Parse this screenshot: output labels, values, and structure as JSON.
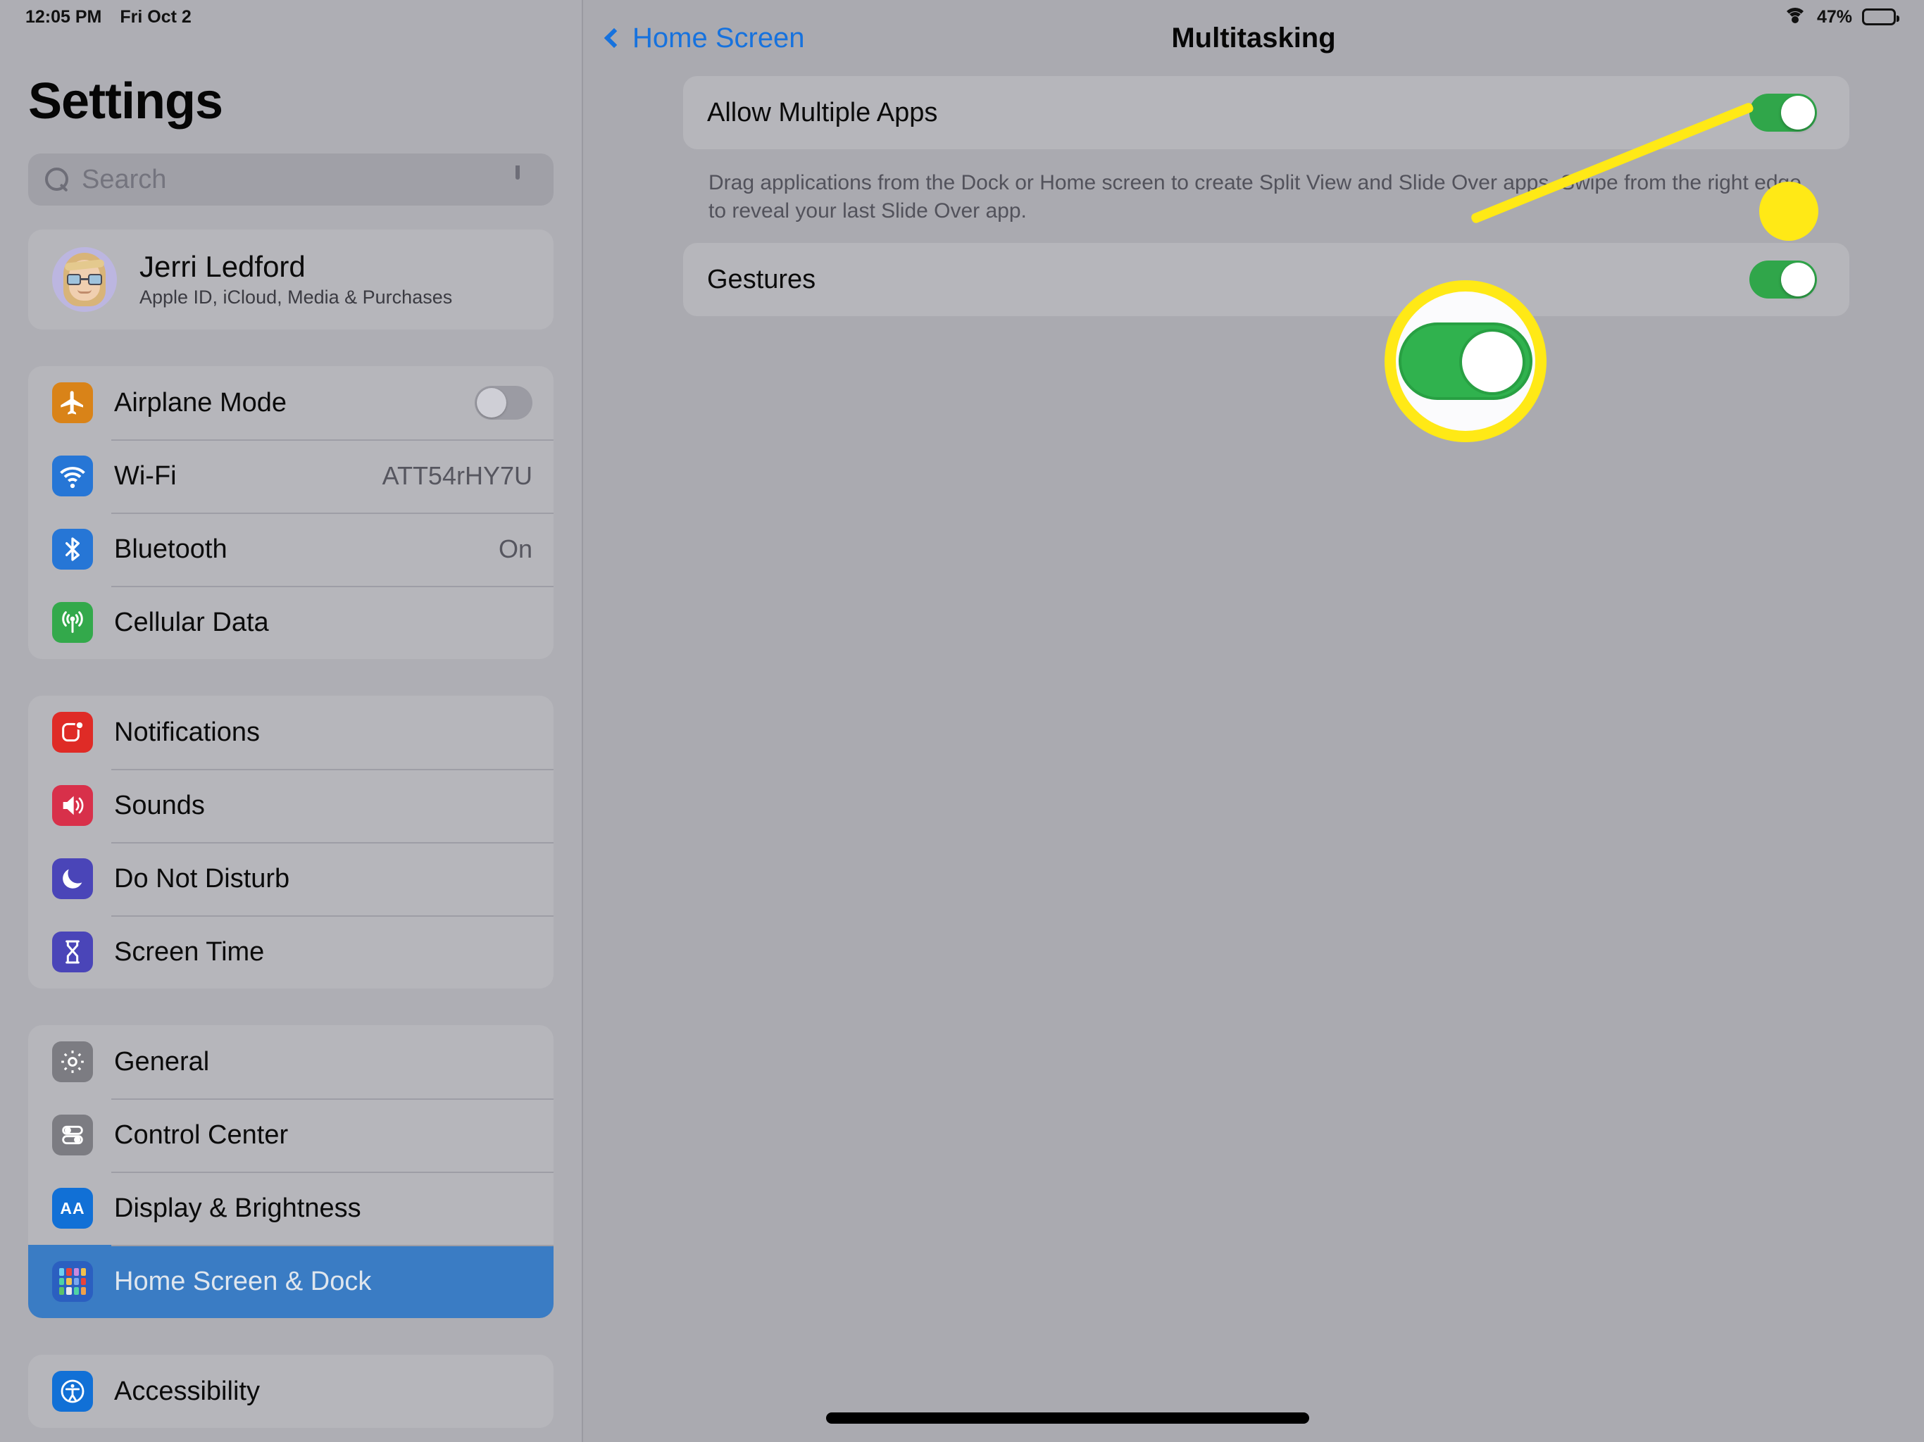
{
  "status_bar": {
    "time": "12:05 PM",
    "date": "Fri Oct 2",
    "wifi_icon": "wifi-icon",
    "battery_percent": "47%",
    "battery_level": 47
  },
  "sidebar": {
    "title": "Settings",
    "search": {
      "placeholder": "Search",
      "search_icon": "search-icon",
      "mic_icon": "microphone-icon"
    },
    "profile": {
      "name": "Jerri Ledford",
      "subtitle": "Apple ID, iCloud, Media & Purchases",
      "avatar_icon": "memoji-avatar"
    },
    "groups": [
      {
        "items": [
          {
            "label": "Airplane Mode",
            "icon": "airplane-icon",
            "color": "#d98318",
            "control": "toggle",
            "toggle_on": false
          },
          {
            "label": "Wi-Fi",
            "icon": "wifi-icon",
            "color": "#2676d6",
            "value": "ATT54rHY7U"
          },
          {
            "label": "Bluetooth",
            "icon": "bluetooth-icon",
            "color": "#2676d6",
            "value": "On"
          },
          {
            "label": "Cellular Data",
            "icon": "cellular-icon",
            "color": "#33a94b",
            "value": ""
          }
        ]
      },
      {
        "items": [
          {
            "label": "Notifications",
            "icon": "notifications-icon",
            "color": "#df2b26",
            "value": ""
          },
          {
            "label": "Sounds",
            "icon": "sounds-icon",
            "color": "#d8304a",
            "value": ""
          },
          {
            "label": "Do Not Disturb",
            "icon": "do-not-disturb-icon",
            "color": "#4a45b8",
            "value": ""
          },
          {
            "label": "Screen Time",
            "icon": "screen-time-icon",
            "color": "#4a45b8",
            "value": ""
          }
        ]
      },
      {
        "items": [
          {
            "label": "General",
            "icon": "gear-icon",
            "color": "#7c7c82",
            "value": ""
          },
          {
            "label": "Control Center",
            "icon": "control-center-icon",
            "color": "#7c7c82",
            "value": ""
          },
          {
            "label": "Display & Brightness",
            "icon": "display-brightness-icon",
            "color": "#1170d6",
            "value": ""
          },
          {
            "label": "Home Screen & Dock",
            "icon": "home-screen-dock-icon",
            "color": "#2b5fc0",
            "value": "",
            "selected": true
          }
        ]
      },
      {
        "items": [
          {
            "label": "Accessibility",
            "icon": "accessibility-icon",
            "color": "#1170d6",
            "value": ""
          }
        ]
      }
    ],
    "selected_item": "Home Screen & Dock"
  },
  "detail": {
    "back_label": "Home Screen",
    "back_icon": "chevron-left-icon",
    "title": "Multitasking",
    "rows": [
      {
        "label": "Allow Multiple Apps",
        "toggle_on": true
      },
      {
        "label": "Gestures",
        "toggle_on": true
      }
    ],
    "footnote": "Drag applications from the Dock or Home screen to create Split View and Slide Over apps. Swipe from the right edge to reveal your last Slide Over app."
  },
  "annotation": {
    "highlight_color": "#ffe916",
    "target": "Allow Multiple Apps toggle",
    "magnified_toggle_on": true
  },
  "home_indicator": {
    "label": "home-indicator"
  }
}
